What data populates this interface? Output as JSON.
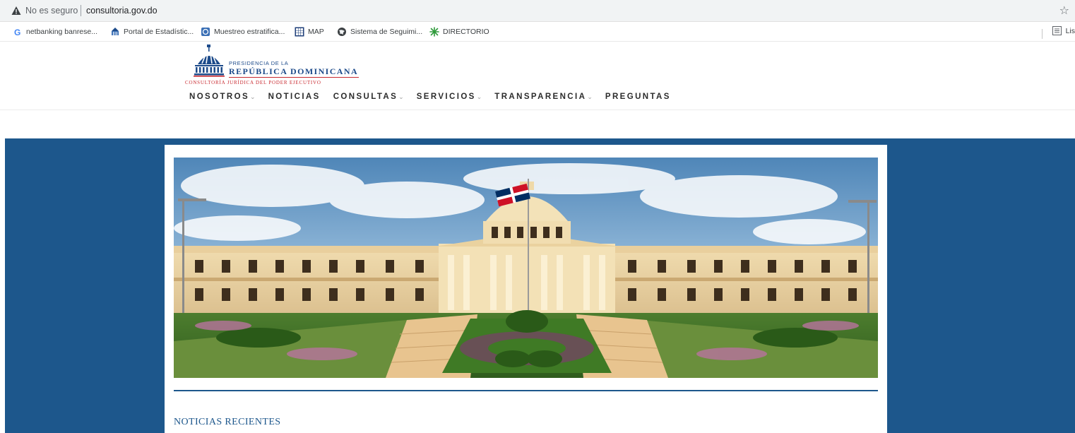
{
  "browser": {
    "security_label": "No es seguro",
    "domain": "consultoria.gov.do",
    "bookmarks": [
      {
        "label": "netbanking banrese...",
        "icon": "google-icon"
      },
      {
        "label": "Portal de Estadístic...",
        "icon": "statistics-portal-icon"
      },
      {
        "label": "Muestreo estratifica...",
        "icon": "sampling-icon"
      },
      {
        "label": "MAP",
        "icon": "grid-app-icon"
      },
      {
        "label": "Sistema de Seguimi...",
        "icon": "globe-icon"
      },
      {
        "label": "DIRECTORIO",
        "icon": "directory-leaf-icon"
      }
    ],
    "reading_list_label": "Lis"
  },
  "site": {
    "logo": {
      "line1": "PRESIDENCIA DE LA",
      "line2": "REPÚBLICA DOMINICANA",
      "line3": "CONSULTORÍA JURÍDICA DEL PODER EJECUTIVO"
    },
    "nav": [
      {
        "label": "NOSOTROS",
        "has_dropdown": true
      },
      {
        "label": "NOTICIAS",
        "has_dropdown": false
      },
      {
        "label": "CONSULTAS",
        "has_dropdown": true
      },
      {
        "label": "SERVICIOS",
        "has_dropdown": true
      },
      {
        "label": "TRANSPARENCIA",
        "has_dropdown": true
      },
      {
        "label": "PREGUNTAS",
        "has_dropdown": false
      }
    ],
    "chevron_glyph": "⌄",
    "section_title": "NOTICIAS RECIENTES",
    "colors": {
      "brand_blue": "#1d578c",
      "logo_blue": "#1c4a8a",
      "logo_red": "#c8282e"
    }
  }
}
